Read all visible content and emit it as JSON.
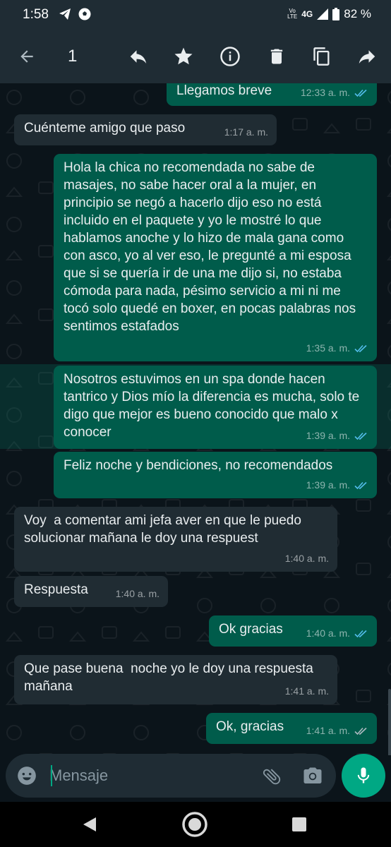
{
  "status_bar": {
    "time": "1:58",
    "volte": "Vo\nLTE",
    "network": "4G",
    "battery": "82 %"
  },
  "toolbar": {
    "selected_count": "1"
  },
  "messages": [
    {
      "dir": "out",
      "text": "Llegamos breve",
      "time": "12:33 a. m.",
      "ticks": "read"
    },
    {
      "dir": "in",
      "text": "Cuénteme amigo que paso",
      "time": "1:17 a. m."
    },
    {
      "dir": "out",
      "text": "Hola la chica no recomendada no sabe de masajes, no sabe hacer oral a la mujer, en principio se negó a hacerlo dijo eso no está incluido en el paquete y yo le mostré lo que hablamos anoche y lo hizo de mala gana como con asco, yo al ver eso, le pregunté a mi esposa que si se quería ir de una me dijo si, no estaba cómoda para nada, pésimo servicio a mi ni me tocó solo quedé en boxer, en pocas palabras nos sentimos estafados",
      "time": "1:35 a. m.",
      "ticks": "read"
    },
    {
      "dir": "out",
      "text": "Nosotros estuvimos en un spa donde hacen tantrico y Dios mío la diferencia es mucha, solo te digo que mejor es bueno conocido que malo x conocer",
      "time": "1:39 a. m.",
      "ticks": "read",
      "selected": true
    },
    {
      "dir": "out",
      "text": "Feliz noche y bendiciones, no recomendados",
      "time": "1:39 a. m.",
      "ticks": "read"
    },
    {
      "dir": "in",
      "text": "Voy  a comentar ami jefa aver en que le puedo solucionar mañana le doy una respuest",
      "time": "1:40 a. m."
    },
    {
      "dir": "in",
      "text": "Respuesta",
      "time": "1:40 a. m."
    },
    {
      "dir": "out",
      "text": "Ok gracias",
      "time": "1:40 a. m.",
      "ticks": "read"
    },
    {
      "dir": "in",
      "text": "Que pase buena  noche yo le doy una respuesta mañana",
      "time": "1:41 a. m."
    },
    {
      "dir": "out",
      "text": "Ok, gracias",
      "time": "1:41 a. m.",
      "ticks": "delivered"
    }
  ],
  "composer": {
    "placeholder": "Mensaje"
  },
  "colors": {
    "outgoing": "#005c4b",
    "incoming": "#202c33",
    "accent": "#00a884",
    "read_tick": "#53bdeb"
  }
}
